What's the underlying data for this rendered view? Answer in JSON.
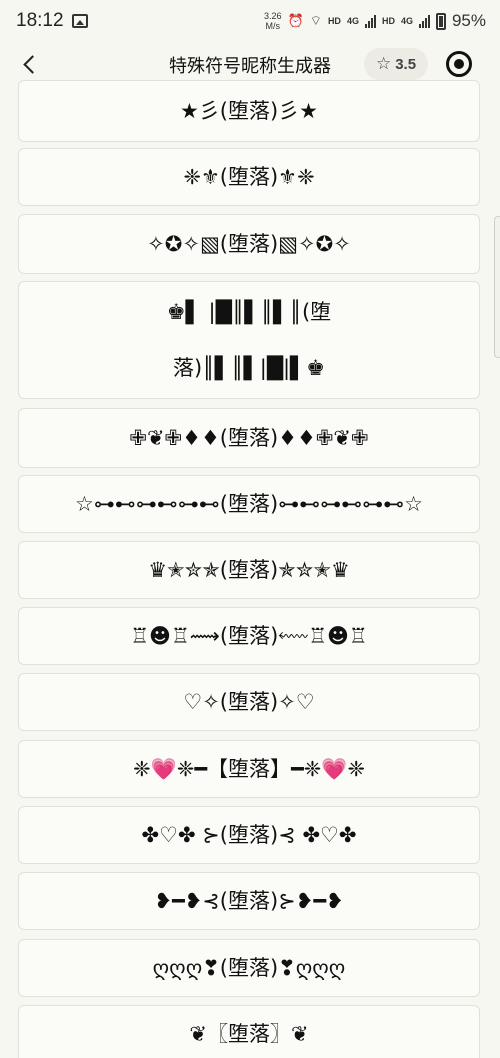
{
  "status_bar": {
    "time": "18:12",
    "speed_value": "3.26",
    "speed_unit": "M/s",
    "hd1": "HD",
    "net1": "4G",
    "hd2": "HD",
    "net2": "4G",
    "battery": "95%"
  },
  "nav": {
    "title": "特殊符号昵称生成器",
    "rating": "3.5"
  },
  "nicknames": [
    {
      "lines": [
        "★彡(堕落)彡★"
      ]
    },
    {
      "lines": [
        "❈⚜(堕落)⚜❈"
      ]
    },
    {
      "lines": [
        "✧✪✧▧(堕落)▧✧✪✧"
      ]
    },
    {
      "lines": [
        "♚▌ |█║▌║▌║(堕",
        "落)║▌║▌|█|▌♚"
      ]
    },
    {
      "lines": [
        "✙❦✙♦♦(堕落)♦♦✙❦✙"
      ]
    },
    {
      "lines": [
        "☆⊶⊷⊶⊷⊶⊷(堕落)⊶⊷⊶⊷⊶⊷☆"
      ]
    },
    {
      "lines": [
        "♛✭✮✯(堕落)✯✮✭♛"
      ]
    },
    {
      "lines": [
        "♖☻♖⟿(堕落)⬳♖☻♖"
      ]
    },
    {
      "lines": [
        "♡✧(堕落)✧♡"
      ]
    },
    {
      "lines": [
        "❈💗❈━【堕落】━❈💗❈"
      ]
    },
    {
      "lines": [
        "✤♡✤ ⊱(堕落)⊰ ✤♡✤"
      ]
    },
    {
      "lines": [
        "❥━❥⊰(堕落)⊱❥━❥"
      ]
    },
    {
      "lines": [
        "ღღღ❣(堕落)❣ღღღ"
      ]
    },
    {
      "lines": [
        "❦〖堕落〗❦"
      ]
    }
  ]
}
